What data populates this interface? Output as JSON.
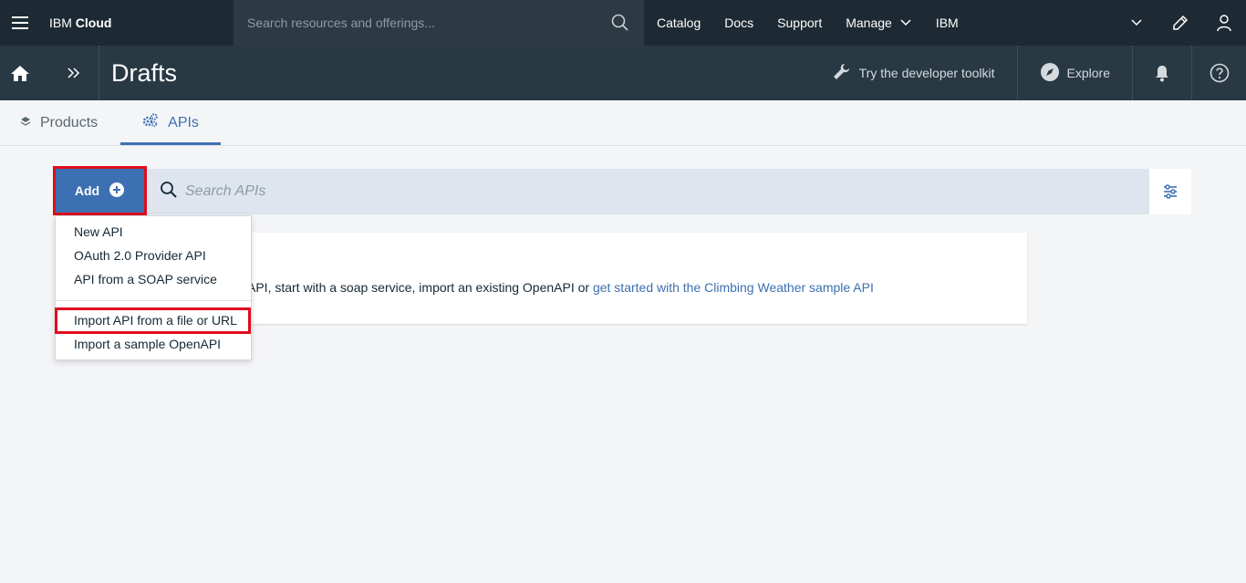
{
  "masthead": {
    "brand_prefix": "IBM",
    "brand_name": "Cloud",
    "search_placeholder": "Search resources and offerings...",
    "nav": [
      "Catalog",
      "Docs",
      "Support",
      "Manage",
      "IBM"
    ]
  },
  "subheader": {
    "title": "Drafts",
    "toolkit_label": "Try the developer toolkit",
    "explore_label": "Explore"
  },
  "tabs": [
    {
      "label": "Products",
      "icon": "layers-icon",
      "active": false
    },
    {
      "label": "APIs",
      "icon": "gears-icon",
      "active": true
    }
  ],
  "toolbar": {
    "add_label": "Add",
    "search_placeholder": "Search APIs"
  },
  "card": {
    "text": "API, start with a soap service, import an existing OpenAPI or ",
    "link": "get started with the Climbing Weather sample API"
  },
  "add_menu": {
    "items": [
      "New API",
      "OAuth 2.0 Provider API",
      "API from a SOAP service",
      "Import API from a file or URL",
      "Import a sample OpenAPI"
    ],
    "highlighted_index": 3
  },
  "colors": {
    "masthead_bg": "#1d2a33",
    "subheader_bg": "#283943",
    "accent": "#3d70b2",
    "highlight": "#e00d1d"
  }
}
